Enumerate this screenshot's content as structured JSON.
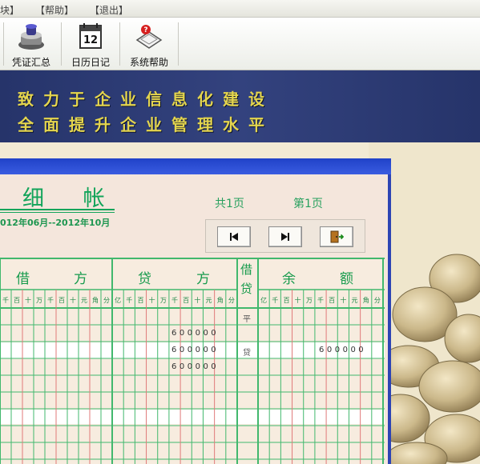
{
  "menu": [
    "块】",
    "【帮助】",
    "【退出】"
  ],
  "toolbar": [
    {
      "label": "凭证汇总",
      "icon": "voucher-stamp-icon"
    },
    {
      "label": "日历日记",
      "icon": "calendar-icon"
    },
    {
      "label": "系统帮助",
      "icon": "help-icon"
    }
  ],
  "banner": {
    "line1": "致力于企业信息化建设",
    "line2": "全面提升企业管理水平"
  },
  "ledger": {
    "title": "细 帐",
    "period": "012年06月--2012年10月",
    "total_pages_label": "共1页",
    "current_page_label": "第1页",
    "nav_buttons": [
      "first-page",
      "next-page",
      "exit"
    ]
  },
  "grid": {
    "headers": {
      "debit": [
        "借",
        "方"
      ],
      "credit": [
        "贷",
        "方"
      ],
      "direction": [
        "借",
        "贷"
      ],
      "balance": [
        "余",
        "额"
      ]
    },
    "debit_digits": [
      "千",
      "百",
      "十",
      "万",
      "千",
      "百",
      "十",
      "元",
      "角",
      "分"
    ],
    "credit_digits": [
      "亿",
      "千",
      "百",
      "十",
      "万",
      "千",
      "百",
      "十",
      "元",
      "角",
      "分"
    ],
    "balance_digits": [
      "亿",
      "千",
      "百",
      "十",
      "万",
      "千",
      "百",
      "十",
      "元",
      "角",
      "分"
    ],
    "rows": [
      {
        "dir": "平",
        "credit": "",
        "balance": ""
      },
      {
        "dir": "",
        "credit": "600000",
        "balance": ""
      },
      {
        "dir": "贷",
        "credit": "600000",
        "balance": "600000"
      },
      {
        "dir": "",
        "credit": "600000",
        "balance": ""
      }
    ]
  },
  "colors": {
    "banner_bg": "#2e3c76",
    "slogan": "#e4d54e",
    "ledger_green": "#12a45a",
    "ledger_bg": "#f4e6dc",
    "title_bar": "#2d44b4"
  }
}
